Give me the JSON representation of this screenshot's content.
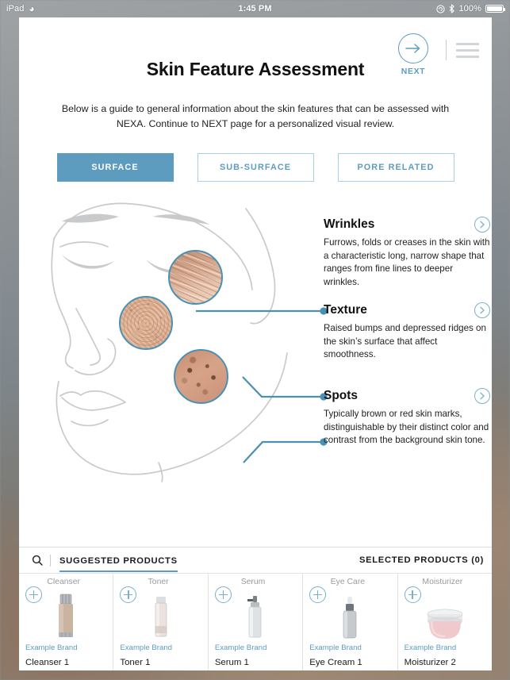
{
  "statusbar": {
    "device": "iPad",
    "wifi_icon": "wifi-icon",
    "time": "1:45 PM",
    "rotation_lock_icon": "rotation-lock-icon",
    "bluetooth_icon": "bluetooth-icon",
    "battery_percent": "100%",
    "battery_icon": "battery-icon"
  },
  "header": {
    "title": "Skin Feature Assessment",
    "next_label": "NEXT",
    "next_icon": "arrow-right-circle-icon",
    "menu_icon": "hamburger-menu-icon"
  },
  "intro": "Below is a guide to general information about the skin features that can be assessed with NEXA. Continue to NEXT page for a personalized visual review.",
  "tabs": [
    {
      "label": "SURFACE",
      "active": true
    },
    {
      "label": "SUB-SURFACE",
      "active": false
    },
    {
      "label": "PORE RELATED",
      "active": false
    }
  ],
  "features": [
    {
      "title": "Wrinkles",
      "description": "Furrows, folds or creases in the skin with a characteristic long, narrow shape that ranges from fine lines to deeper wrinkles.",
      "chevron_icon": "chevron-right-circle-icon"
    },
    {
      "title": "Texture",
      "description": "Raised bumps and depressed ridges on the skin’s surface that affect smoothness.",
      "chevron_icon": "chevron-right-circle-icon"
    },
    {
      "title": "Spots",
      "description": "Typically brown or red skin marks, distinguishable by their distinct color and contrast from the background skin tone.",
      "chevron_icon": "chevron-right-circle-icon"
    }
  ],
  "products_panel": {
    "search_icon": "search-icon",
    "suggested_tab": "SUGGESTED PRODUCTS",
    "selected_tab": "SELECTED PRODUCTS (0)",
    "items": [
      {
        "category": "Cleanser",
        "brand": "Example Brand",
        "name": "Cleanser 1",
        "add_icon": "plus-circle-icon",
        "image": "cleanser-bottle-image"
      },
      {
        "category": "Toner",
        "brand": "Example Brand",
        "name": "Toner 1",
        "add_icon": "plus-circle-icon",
        "image": "toner-bottle-image"
      },
      {
        "category": "Serum",
        "brand": "Example Brand",
        "name": "Serum 1",
        "add_icon": "plus-circle-icon",
        "image": "serum-pump-image"
      },
      {
        "category": "Eye Care",
        "brand": "Example Brand",
        "name": "Eye Cream 1",
        "add_icon": "plus-circle-icon",
        "image": "dropper-bottle-image"
      },
      {
        "category": "Moisturizer",
        "brand": "Example Brand",
        "name": "Moisturizer 2",
        "add_icon": "plus-circle-icon",
        "image": "cream-jar-image"
      }
    ]
  },
  "colors": {
    "accent_blue": "#5d9cbf",
    "line_blue": "#4a90b5",
    "face_line": "#c9cacb",
    "text_dark": "#111111"
  }
}
